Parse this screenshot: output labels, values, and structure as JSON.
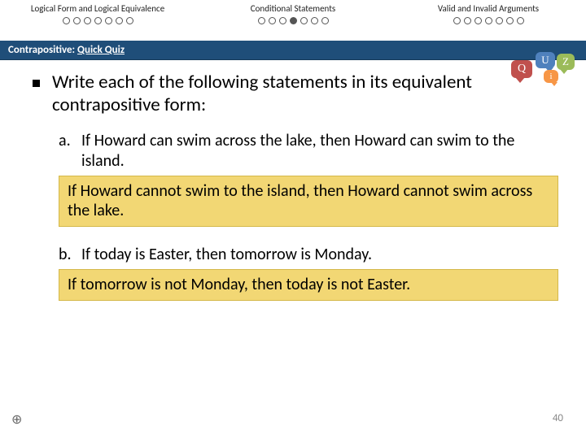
{
  "nav": {
    "sections": [
      {
        "title": "Logical Form and Logical Equivalence",
        "dots": 7,
        "active": -1
      },
      {
        "title": "Conditional Statements",
        "dots": 7,
        "active": 3
      },
      {
        "title": "Valid and Invalid Arguments",
        "dots": 7,
        "active": -1
      }
    ]
  },
  "subtitle": {
    "prefix": "Contrapositive: ",
    "quiz": "Quick Quiz"
  },
  "quizIcon": {
    "q": "Q",
    "u": "U",
    "z": "Z",
    "i": "i"
  },
  "lead": "Write each of the following statements in its equivalent contrapositive form:",
  "items": [
    {
      "label": "a.",
      "stmt": "If Howard can swim across the lake, then Howard can swim to the island.",
      "ans": "If Howard cannot swim to the island, then Howard cannot swim across the lake."
    },
    {
      "label": "b.",
      "stmt": "If today is Easter, then tomorrow is Monday.",
      "ans": "If tomorrow is not Monday, then today is not Easter."
    }
  ],
  "pageNum": "40",
  "cornerMark": "⊕"
}
